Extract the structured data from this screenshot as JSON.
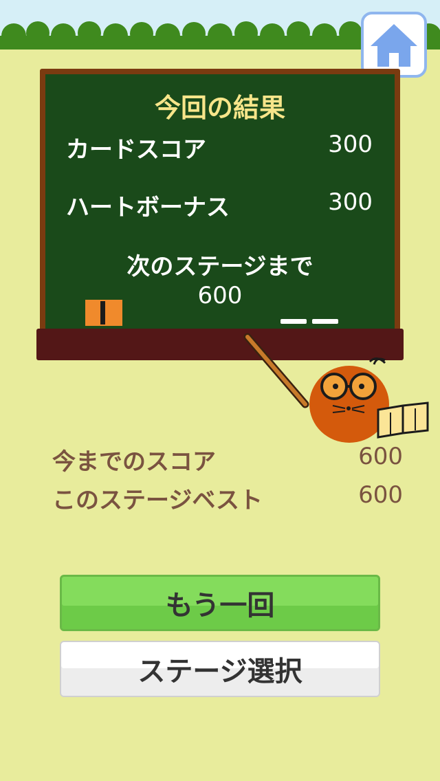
{
  "colors": {
    "background": "#e8ec9c",
    "chalkboard": "#1a4a1a",
    "title_chalk": "#f7e58a",
    "stat_text": "#7a5340",
    "retry_button": "#84dc5c",
    "home_icon": "#7aa6ec"
  },
  "home_button": {
    "icon": "home-icon"
  },
  "result": {
    "title": "今回の結果",
    "card_score_label": "カードスコア",
    "card_score_value": "300",
    "heart_bonus_label": "ハートボーナス",
    "heart_bonus_value": "300",
    "next_stage_label": "次のステージまで",
    "next_stage_value": "600"
  },
  "stats": {
    "total_score_label": "今までのスコア",
    "total_score_value": "600",
    "stage_best_label": "このステージベスト",
    "stage_best_value": "600"
  },
  "buttons": {
    "retry_label": "もう一回",
    "stage_select_label": "ステージ選択"
  }
}
